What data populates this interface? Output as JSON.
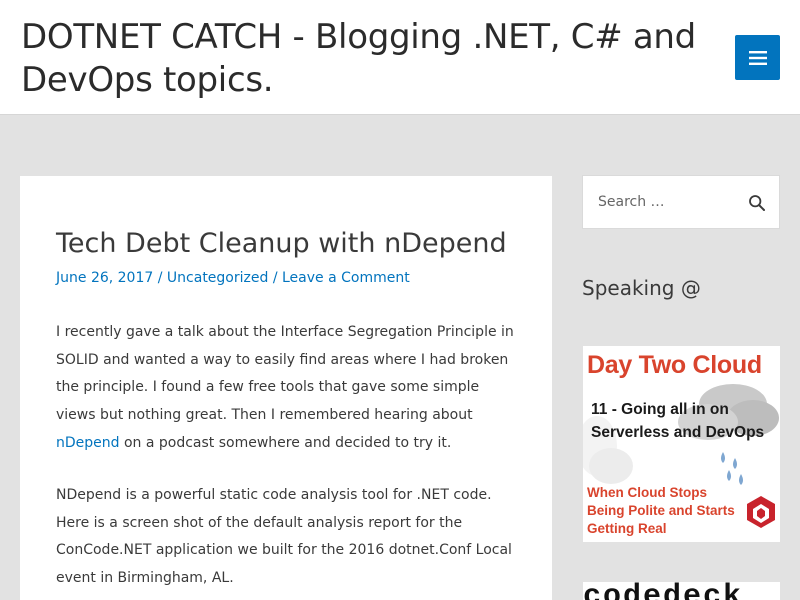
{
  "header": {
    "site_title": "DOTNET CATCH - Blogging .NET, C# and DevOps topics.",
    "menu_icon": "hamburger-menu-icon",
    "accent_color": "#0274be"
  },
  "post": {
    "title": "Tech Debt Cleanup with nDepend",
    "date": "June 26, 2017",
    "category": "Uncategorized",
    "comment_link": "Leave a Comment",
    "separator": " / ",
    "paragraph1_before": "I recently gave a talk about the Interface Segregation Principle in SOLID and wanted a way to easily find areas where I had broken the principle. I found a few free tools that gave some simple views but nothing great.  Then I remembered hearing about ",
    "paragraph1_link": "nDepend",
    "paragraph1_after": " on a podcast somewhere and decided to try it.",
    "paragraph2": "NDepend is a powerful static code analysis tool for .NET code.  Here is a screen shot of the default analysis report for the ConCode.NET application we built for the 2016 dotnet.Conf Local event in Birmingham, AL."
  },
  "sidebar": {
    "search_placeholder": "Search …",
    "search_icon": "search-icon",
    "speaking_title": "Speaking @",
    "banner": {
      "title": "Day Two Cloud",
      "subtitle": "11 - Going all in on Serverless and DevOps",
      "footer": "When Cloud Stops Being Polite and Starts Getting Real",
      "title_color": "#d9442d"
    },
    "banner2_text": "codedeck"
  }
}
